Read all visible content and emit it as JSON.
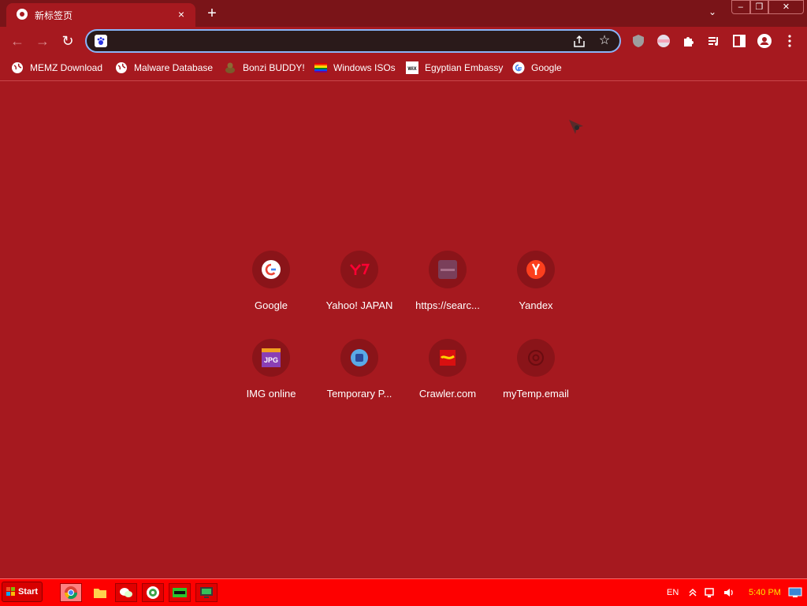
{
  "tab": {
    "title": "新标签页",
    "close": "×"
  },
  "new_tab": "+",
  "tab_search": "⌄",
  "window": {
    "minimize": "–",
    "maximize": "❐",
    "close": "✕"
  },
  "nav": {
    "back": "←",
    "forward": "→",
    "reload": "↻"
  },
  "omnibox": {
    "value": "",
    "placeholder": "",
    "star": "☆"
  },
  "bookmarks": [
    {
      "label": "MEMZ Download",
      "icon": "globe-icon"
    },
    {
      "label": "Malware Database",
      "icon": "globe-icon"
    },
    {
      "label": "Bonzi BUDDY!",
      "icon": "bonzi-icon"
    },
    {
      "label": "Windows ISOs",
      "icon": "rainbow-flag-icon"
    },
    {
      "label": "Egyptian Embassy",
      "icon": "wix-icon"
    },
    {
      "label": "Google",
      "icon": "google-icon"
    }
  ],
  "shortcuts": [
    {
      "label": "Google"
    },
    {
      "label": "Yahoo! JAPAN"
    },
    {
      "label": "https://searc..."
    },
    {
      "label": "Yandex"
    },
    {
      "label": "IMG online"
    },
    {
      "label": "Temporary P..."
    },
    {
      "label": "Crawler.com"
    },
    {
      "label": "myTemp.email"
    }
  ],
  "taskbar": {
    "start_label": "Start",
    "language": "EN",
    "clock": "5:40 PM"
  },
  "colors": {
    "page_bg": "#a6191f",
    "titlebar": "#7a1418",
    "taskbar": "#fe0000",
    "focus_ring": "#8ab4f8"
  }
}
